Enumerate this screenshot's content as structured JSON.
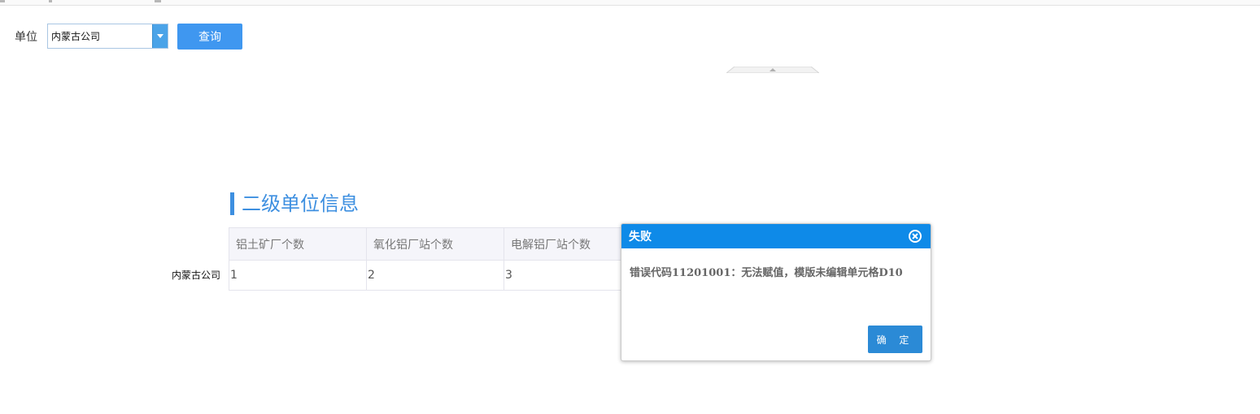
{
  "filter": {
    "label": "单位",
    "select_value": "内蒙古公司",
    "query_button": "查询"
  },
  "section": {
    "title": "二级单位信息"
  },
  "table": {
    "headers": [
      "铝土矿厂个数",
      "氧化铝厂站个数",
      "电解铝厂站个数"
    ],
    "row_label": "内蒙古公司",
    "values": [
      "1",
      "2",
      "3"
    ]
  },
  "dialog": {
    "title": "失败",
    "message": "错误代码11201001：无法赋值，模版未编辑单元格D10",
    "ok_button": "确 定"
  },
  "colors": {
    "accent": "#3f97f0",
    "dialog_header": "#0e8ae8",
    "section_title": "#3d8fe0"
  }
}
